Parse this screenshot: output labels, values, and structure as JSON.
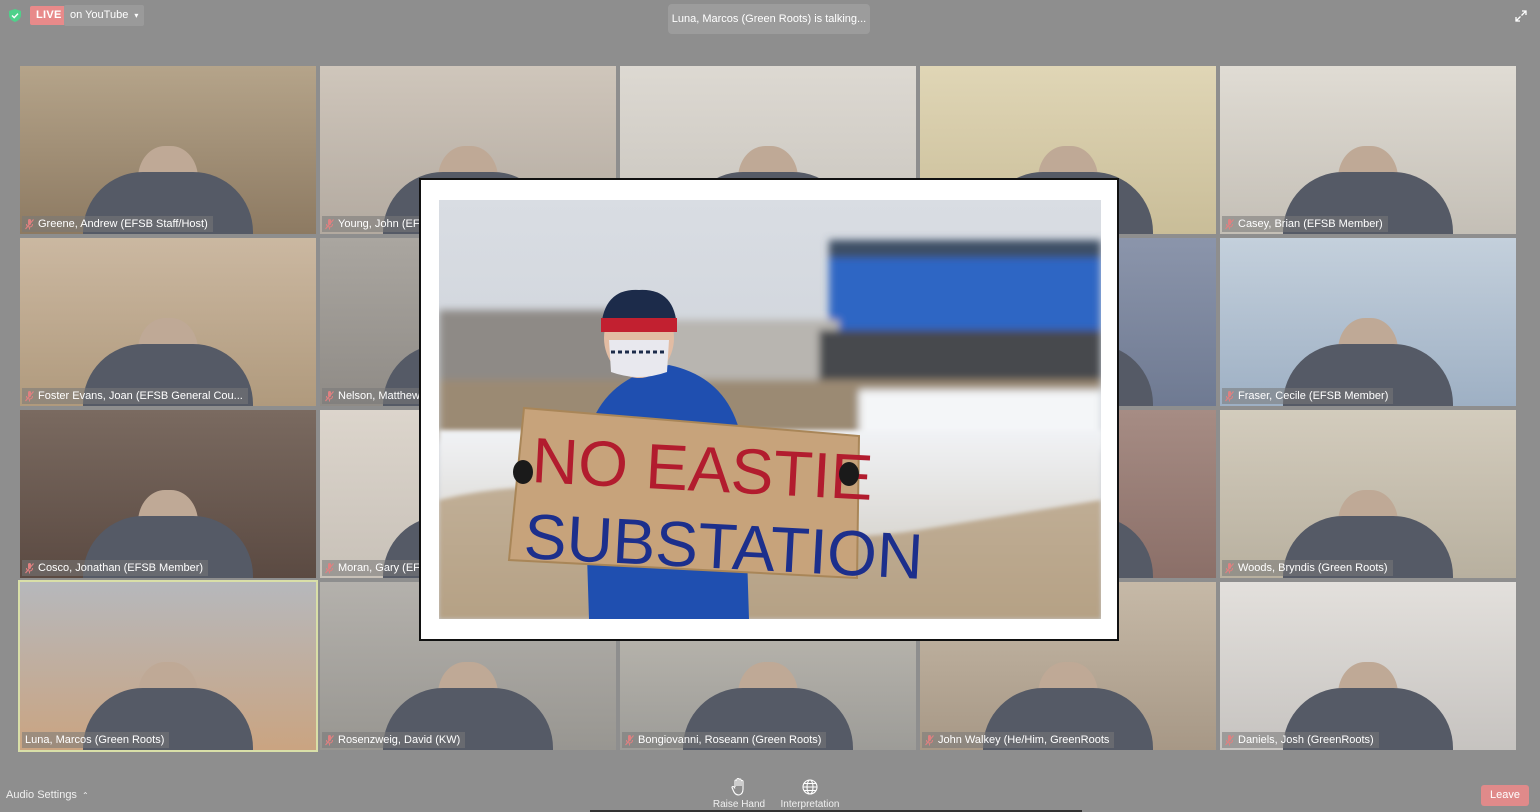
{
  "top_bar": {
    "live_label": "LIVE",
    "live_target": "on YouTube",
    "talking_status": "Luna, Marcos (Green Roots) is talking..."
  },
  "participants": [
    {
      "name": "Greene, Andrew (EFSB Staff/Host)",
      "muted": true,
      "active": false
    },
    {
      "name": "Young, John (EFSB...",
      "muted": true,
      "active": false
    },
    {
      "name": "",
      "muted": true,
      "active": false
    },
    {
      "name": "",
      "muted": true,
      "active": false
    },
    {
      "name": "Casey, Brian (EFSB Member)",
      "muted": true,
      "active": false
    },
    {
      "name": "Foster Evans, Joan (EFSB General Cou...",
      "muted": true,
      "active": false
    },
    {
      "name": "Nelson, Matthew...",
      "muted": true,
      "active": false
    },
    {
      "name": "",
      "muted": true,
      "active": false
    },
    {
      "name": "",
      "muted": true,
      "active": false
    },
    {
      "name": "Fraser, Cecile (EFSB Member)",
      "muted": true,
      "active": false
    },
    {
      "name": "Cosco, Jonathan (EFSB Member)",
      "muted": true,
      "active": false
    },
    {
      "name": "Moran, Gary (EF...",
      "muted": true,
      "active": false
    },
    {
      "name": "",
      "muted": true,
      "active": false
    },
    {
      "name": "",
      "muted": true,
      "active": false
    },
    {
      "name": "Woods, Bryndis (Green Roots)",
      "muted": true,
      "active": false
    },
    {
      "name": "Luna, Marcos (Green Roots)",
      "muted": false,
      "active": true
    },
    {
      "name": "Rosenzweig, David (KW)",
      "muted": true,
      "active": false
    },
    {
      "name": "Bongiovanni, Roseann (Green Roots)",
      "muted": true,
      "active": false
    },
    {
      "name": "John Walkey (He/Him, GreenRoots",
      "muted": true,
      "active": false
    },
    {
      "name": "Daniels, Josh (GreenRoots)",
      "muted": true,
      "active": false
    }
  ],
  "overlay_photo": {
    "sign_line1": "NO EASTIE",
    "sign_line2": "SUBSTATION"
  },
  "bottom_bar": {
    "audio_settings": "Audio Settings",
    "raise_hand": "Raise Hand",
    "interpretation": "Interpretation",
    "leave": "Leave"
  },
  "colors": {
    "live_badge": "#e88a8a",
    "leave_button": "#e08a8a",
    "active_speaker_border": "#d9dfa8",
    "muted_mic": "#e08080"
  }
}
